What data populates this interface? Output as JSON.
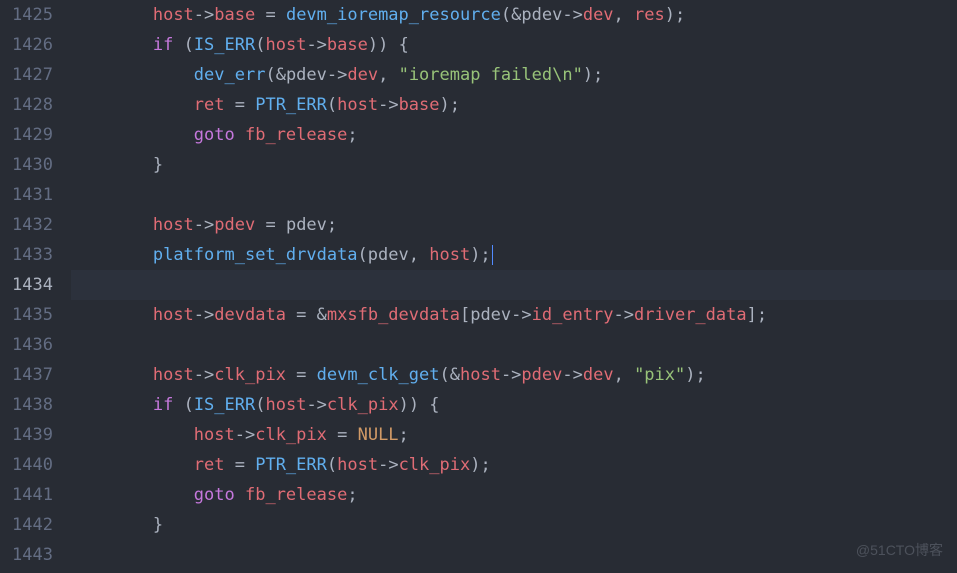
{
  "editor": {
    "active_line": 1434,
    "lines": [
      {
        "num": 1425,
        "indent": 2,
        "tokens": [
          {
            "t": "var",
            "s": "host"
          },
          {
            "t": "op",
            "s": "->"
          },
          {
            "t": "mem",
            "s": "base"
          },
          {
            "t": "op",
            "s": " = "
          },
          {
            "t": "fn",
            "s": "devm_ioremap_resource"
          },
          {
            "t": "op",
            "s": "("
          },
          {
            "t": "op",
            "s": "&"
          },
          {
            "t": "parlight",
            "s": "pdev"
          },
          {
            "t": "op",
            "s": "->"
          },
          {
            "t": "mem",
            "s": "dev"
          },
          {
            "t": "op",
            "s": ", "
          },
          {
            "t": "var",
            "s": "res"
          },
          {
            "t": "op",
            "s": ");"
          }
        ]
      },
      {
        "num": 1426,
        "indent": 2,
        "tokens": [
          {
            "t": "kw",
            "s": "if"
          },
          {
            "t": "op",
            "s": " ("
          },
          {
            "t": "fn",
            "s": "IS_ERR"
          },
          {
            "t": "op",
            "s": "("
          },
          {
            "t": "var",
            "s": "host"
          },
          {
            "t": "op",
            "s": "->"
          },
          {
            "t": "mem",
            "s": "base"
          },
          {
            "t": "op",
            "s": ")) {"
          }
        ]
      },
      {
        "num": 1427,
        "indent": 3,
        "tokens": [
          {
            "t": "fn",
            "s": "dev_err"
          },
          {
            "t": "op",
            "s": "("
          },
          {
            "t": "op",
            "s": "&"
          },
          {
            "t": "parlight",
            "s": "pdev"
          },
          {
            "t": "op",
            "s": "->"
          },
          {
            "t": "mem",
            "s": "dev"
          },
          {
            "t": "op",
            "s": ", "
          },
          {
            "t": "str",
            "s": "\"ioremap failed\\n\""
          },
          {
            "t": "op",
            "s": ");"
          }
        ]
      },
      {
        "num": 1428,
        "indent": 3,
        "tokens": [
          {
            "t": "var",
            "s": "ret"
          },
          {
            "t": "op",
            "s": " = "
          },
          {
            "t": "fn",
            "s": "PTR_ERR"
          },
          {
            "t": "op",
            "s": "("
          },
          {
            "t": "var",
            "s": "host"
          },
          {
            "t": "op",
            "s": "->"
          },
          {
            "t": "mem",
            "s": "base"
          },
          {
            "t": "op",
            "s": ");"
          }
        ]
      },
      {
        "num": 1429,
        "indent": 3,
        "tokens": [
          {
            "t": "kw",
            "s": "goto"
          },
          {
            "t": "op",
            "s": " "
          },
          {
            "t": "var",
            "s": "fb_release"
          },
          {
            "t": "op",
            "s": ";"
          }
        ]
      },
      {
        "num": 1430,
        "indent": 2,
        "tokens": [
          {
            "t": "op",
            "s": "}"
          }
        ]
      },
      {
        "num": 1431,
        "indent": 0,
        "tokens": []
      },
      {
        "num": 1432,
        "indent": 2,
        "tokens": [
          {
            "t": "var",
            "s": "host"
          },
          {
            "t": "op",
            "s": "->"
          },
          {
            "t": "mem",
            "s": "pdev"
          },
          {
            "t": "op",
            "s": " = "
          },
          {
            "t": "parlight",
            "s": "pdev"
          },
          {
            "t": "op",
            "s": ";"
          }
        ]
      },
      {
        "num": 1433,
        "indent": 2,
        "tokens": [
          {
            "t": "fn",
            "s": "platform_set_drvdata"
          },
          {
            "t": "op",
            "s": "("
          },
          {
            "t": "parlight",
            "s": "pdev"
          },
          {
            "t": "op",
            "s": ", "
          },
          {
            "t": "var",
            "s": "host"
          },
          {
            "t": "op",
            "s": ");"
          },
          {
            "t": "cursor",
            "s": ""
          }
        ]
      },
      {
        "num": 1434,
        "indent": 0,
        "tokens": [],
        "active": true
      },
      {
        "num": 1435,
        "indent": 2,
        "tokens": [
          {
            "t": "var",
            "s": "host"
          },
          {
            "t": "op",
            "s": "->"
          },
          {
            "t": "mem",
            "s": "devdata"
          },
          {
            "t": "op",
            "s": " = &"
          },
          {
            "t": "var",
            "s": "mxsfb_devdata"
          },
          {
            "t": "op",
            "s": "["
          },
          {
            "t": "parlight",
            "s": "pdev"
          },
          {
            "t": "op",
            "s": "->"
          },
          {
            "t": "mem",
            "s": "id_entry"
          },
          {
            "t": "op",
            "s": "->"
          },
          {
            "t": "mem",
            "s": "driver_data"
          },
          {
            "t": "op",
            "s": "];"
          }
        ]
      },
      {
        "num": 1436,
        "indent": 0,
        "tokens": []
      },
      {
        "num": 1437,
        "indent": 2,
        "tokens": [
          {
            "t": "var",
            "s": "host"
          },
          {
            "t": "op",
            "s": "->"
          },
          {
            "t": "mem",
            "s": "clk_pix"
          },
          {
            "t": "op",
            "s": " = "
          },
          {
            "t": "fn",
            "s": "devm_clk_get"
          },
          {
            "t": "op",
            "s": "("
          },
          {
            "t": "op",
            "s": "&"
          },
          {
            "t": "var",
            "s": "host"
          },
          {
            "t": "op",
            "s": "->"
          },
          {
            "t": "mem",
            "s": "pdev"
          },
          {
            "t": "op",
            "s": "->"
          },
          {
            "t": "mem",
            "s": "dev"
          },
          {
            "t": "op",
            "s": ", "
          },
          {
            "t": "str",
            "s": "\"pix\""
          },
          {
            "t": "op",
            "s": ");"
          }
        ]
      },
      {
        "num": 1438,
        "indent": 2,
        "tokens": [
          {
            "t": "kw",
            "s": "if"
          },
          {
            "t": "op",
            "s": " ("
          },
          {
            "t": "fn",
            "s": "IS_ERR"
          },
          {
            "t": "op",
            "s": "("
          },
          {
            "t": "var",
            "s": "host"
          },
          {
            "t": "op",
            "s": "->"
          },
          {
            "t": "mem",
            "s": "clk_pix"
          },
          {
            "t": "op",
            "s": ")) {"
          }
        ]
      },
      {
        "num": 1439,
        "indent": 3,
        "tokens": [
          {
            "t": "var",
            "s": "host"
          },
          {
            "t": "op",
            "s": "->"
          },
          {
            "t": "mem",
            "s": "clk_pix"
          },
          {
            "t": "op",
            "s": " = "
          },
          {
            "t": "const",
            "s": "NULL"
          },
          {
            "t": "op",
            "s": ";"
          }
        ]
      },
      {
        "num": 1440,
        "indent": 3,
        "tokens": [
          {
            "t": "var",
            "s": "ret"
          },
          {
            "t": "op",
            "s": " = "
          },
          {
            "t": "fn",
            "s": "PTR_ERR"
          },
          {
            "t": "op",
            "s": "("
          },
          {
            "t": "var",
            "s": "host"
          },
          {
            "t": "op",
            "s": "->"
          },
          {
            "t": "mem",
            "s": "clk_pix"
          },
          {
            "t": "op",
            "s": ");"
          }
        ]
      },
      {
        "num": 1441,
        "indent": 3,
        "tokens": [
          {
            "t": "kw",
            "s": "goto"
          },
          {
            "t": "op",
            "s": " "
          },
          {
            "t": "var",
            "s": "fb_release"
          },
          {
            "t": "op",
            "s": ";"
          }
        ]
      },
      {
        "num": 1442,
        "indent": 2,
        "tokens": [
          {
            "t": "op",
            "s": "}"
          }
        ]
      },
      {
        "num": 1443,
        "indent": 0,
        "tokens": []
      }
    ]
  },
  "watermark": "@51CTO博客"
}
